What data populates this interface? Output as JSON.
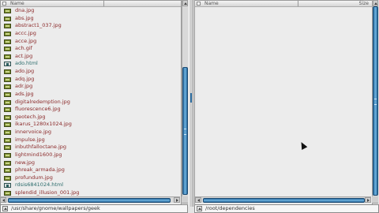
{
  "left_pane": {
    "header": {
      "name_label": "Name"
    },
    "files": [
      {
        "name": "dna.jpg",
        "type": "image"
      },
      {
        "name": "abs.jpg",
        "type": "image"
      },
      {
        "name": "abstract1_037.jpg",
        "type": "image"
      },
      {
        "name": "accc.jpg",
        "type": "image"
      },
      {
        "name": "acce.jpg",
        "type": "image"
      },
      {
        "name": "ach.gif",
        "type": "image"
      },
      {
        "name": "act.jpg",
        "type": "image"
      },
      {
        "name": "ado.html",
        "type": "html"
      },
      {
        "name": "ado.jpg",
        "type": "image"
      },
      {
        "name": "adq.jpg",
        "type": "image"
      },
      {
        "name": "adr.jpg",
        "type": "image"
      },
      {
        "name": "ads.jpg",
        "type": "image"
      },
      {
        "name": "digitalredemption.jpg",
        "type": "image"
      },
      {
        "name": "fluorescence6.jpg",
        "type": "image"
      },
      {
        "name": "geotech.jpg",
        "type": "image"
      },
      {
        "name": "ikarus_1280x1024.jpg",
        "type": "image"
      },
      {
        "name": "innervoice.jpg",
        "type": "image"
      },
      {
        "name": "impulse.jpg",
        "type": "image"
      },
      {
        "name": "inbuthfalloctane.jpg",
        "type": "image"
      },
      {
        "name": "lightmind1600.jpg",
        "type": "image"
      },
      {
        "name": "new.jpg",
        "type": "image"
      },
      {
        "name": "phreak_armada.jpg",
        "type": "image"
      },
      {
        "name": "profundum.jpg",
        "type": "image"
      },
      {
        "name": "rdsis6841024.html",
        "type": "html"
      },
      {
        "name": "splendid_illusion_001.jpg",
        "type": "image"
      }
    ],
    "path": "/usr/share/gnome/wallpapers/geek"
  },
  "right_pane": {
    "header": {
      "name_label": "Name",
      "size_label": "Size"
    },
    "files": [],
    "path": "/root/dependencies"
  },
  "scroll": {
    "left_vertical_fraction": 0.62,
    "right_vertical_fraction": 1.0
  }
}
